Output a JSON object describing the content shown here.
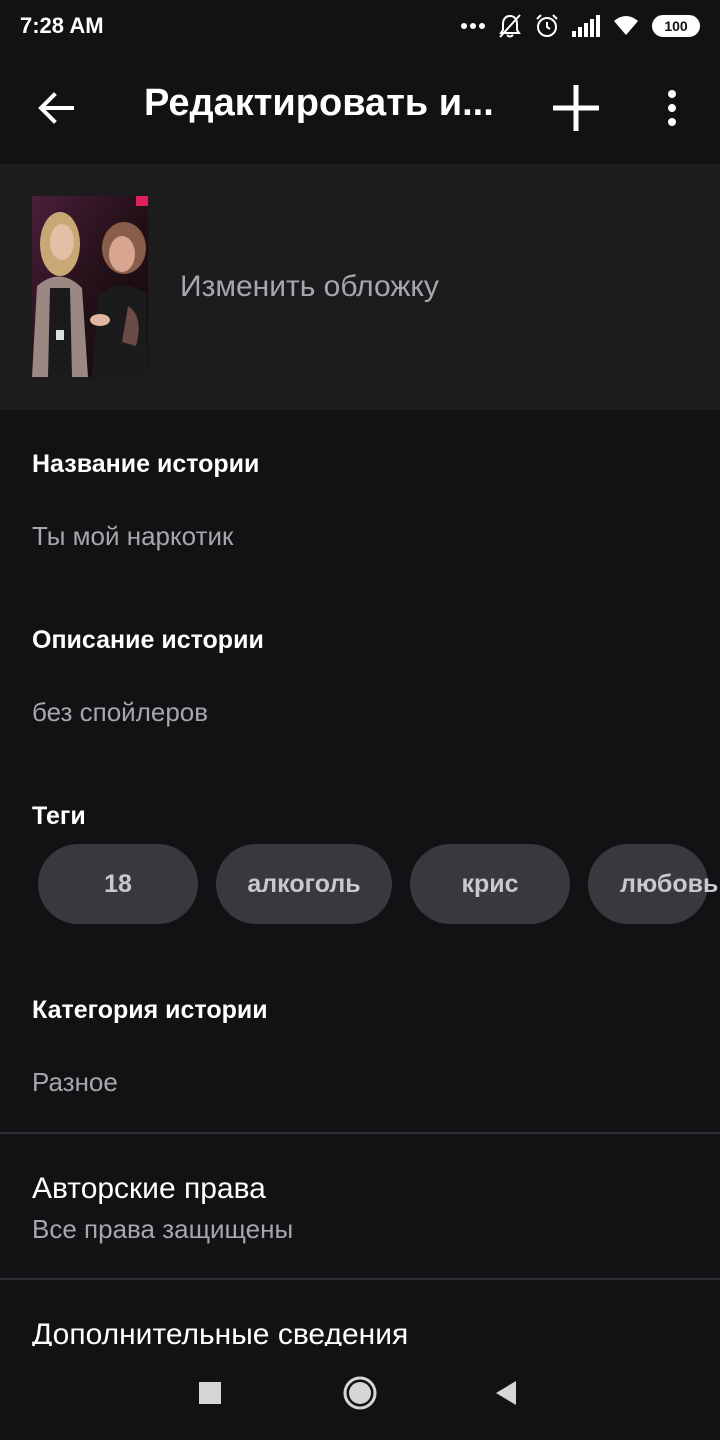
{
  "status_bar": {
    "time": "7:28 AM",
    "battery": "100",
    "icons": [
      "more-dots-icon",
      "notifications-off-icon",
      "alarm-icon",
      "signal-icon",
      "wifi-icon",
      "battery-icon"
    ]
  },
  "toolbar": {
    "title": "Редактировать и...",
    "icons": [
      "back-arrow-icon",
      "plus-icon",
      "more-vert-icon"
    ]
  },
  "cover": {
    "change_label": "Изменить обложку"
  },
  "fields": {
    "title_label": "Название истории",
    "title_value": "Ты мой наркотик",
    "description_label": "Описание истории",
    "description_value": "без спойлеров",
    "tags_label": "Теги",
    "tags": [
      "18",
      "алкоголь",
      "крис",
      "любовь"
    ],
    "category_label": "Категория истории",
    "category_value": "Разное"
  },
  "copyright": {
    "title": "Авторские права",
    "value": "Все права защищены"
  },
  "additional": {
    "title": "Дополнительные сведения"
  },
  "nav_bar": {
    "icons": [
      "recents-square-icon",
      "home-circle-icon",
      "back-triangle-icon"
    ]
  },
  "colors": {
    "background": "#121114",
    "cover_bg": "#1c1b1e",
    "tag_bg": "#39383d",
    "secondary_text": "#a7a6ab"
  }
}
